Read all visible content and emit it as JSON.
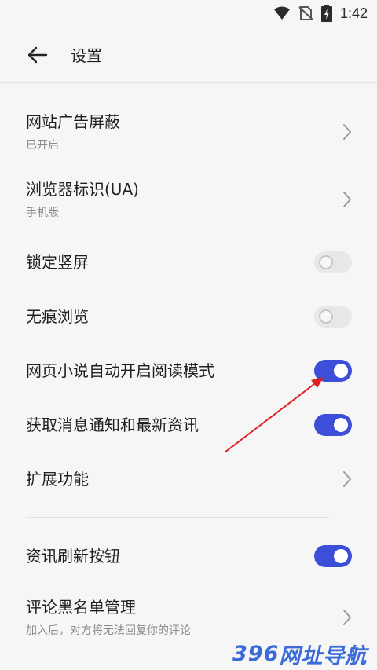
{
  "status_bar": {
    "time": "1:42",
    "icons": [
      "wifi-icon",
      "no-sim-icon",
      "battery-charging-icon"
    ]
  },
  "app_bar": {
    "title": "设置",
    "back_icon": "arrow-left-icon"
  },
  "settings": [
    {
      "key": "ad_block",
      "label": "网站广告屏蔽",
      "sub": "已开启",
      "control": "chevron"
    },
    {
      "key": "ua",
      "label": "浏览器标识(UA)",
      "sub": "手机版",
      "control": "chevron"
    },
    {
      "key": "lock_portrait",
      "label": "锁定竖屏",
      "control": "switch",
      "on": false
    },
    {
      "key": "incognito",
      "label": "无痕浏览",
      "control": "switch",
      "on": false
    },
    {
      "key": "novel_reader",
      "label": "网页小说自动开启阅读模式",
      "control": "switch",
      "on": true
    },
    {
      "key": "news_notify",
      "label": "获取消息通知和最新资讯",
      "control": "switch",
      "on": true
    },
    {
      "key": "extensions",
      "label": "扩展功能",
      "control": "chevron"
    },
    {
      "key": "news_refresh_btn",
      "label": "资讯刷新按钮",
      "control": "switch",
      "on": true
    },
    {
      "key": "comment_blacklist",
      "label": "评论黑名单管理",
      "sub": "加入后，对方将无法回复你的评论",
      "control": "chevron"
    }
  ],
  "watermark": {
    "num": "396",
    "cn": "网址导航"
  },
  "colors": {
    "accent": "#3d4ed8",
    "annotation_arrow": "#e02020"
  }
}
